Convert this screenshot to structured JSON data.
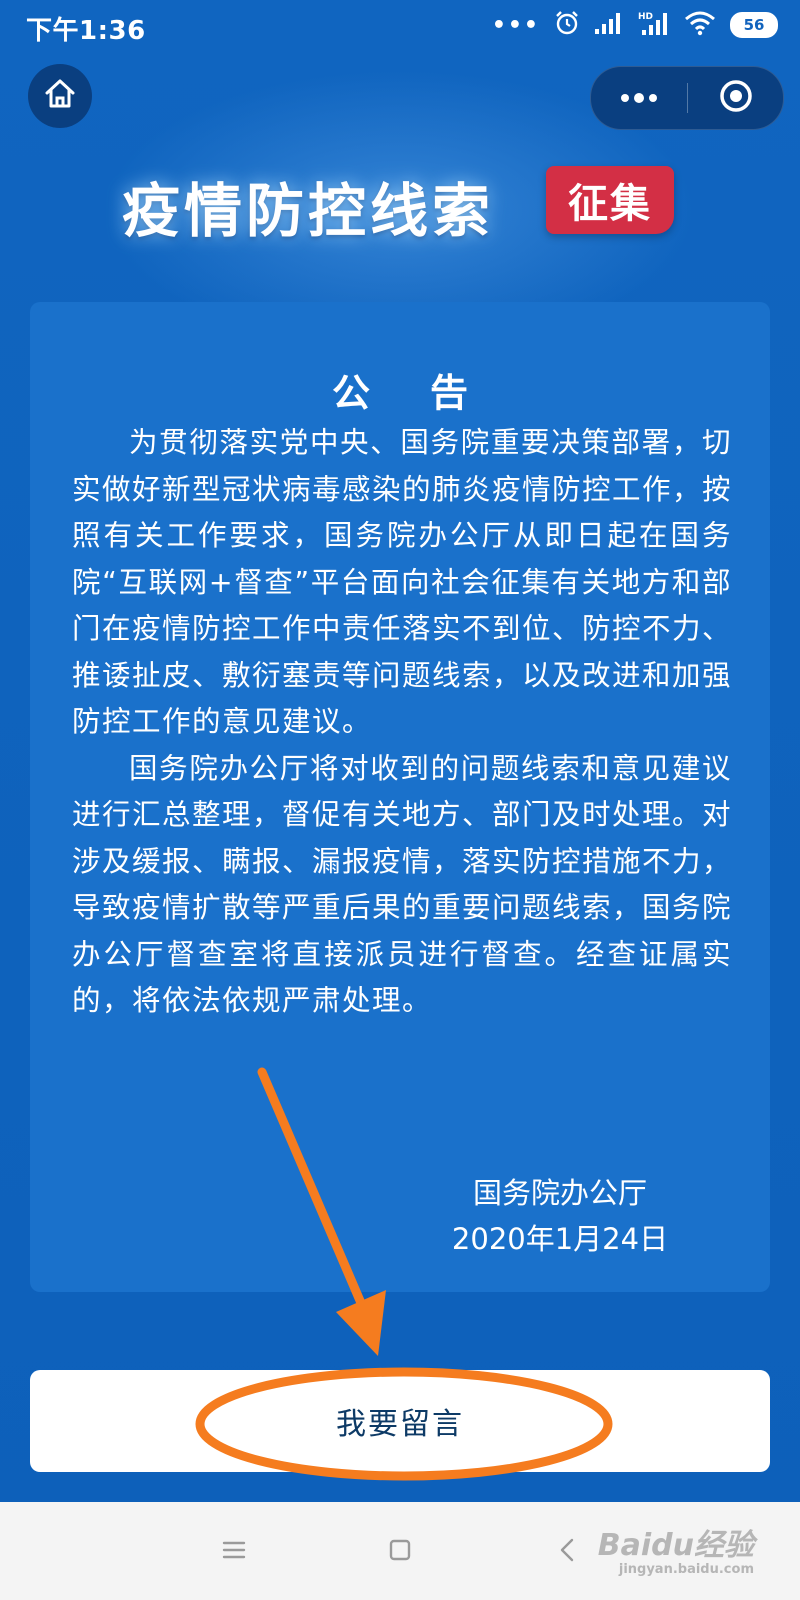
{
  "status_bar": {
    "time": "下午1:36",
    "dots": "•••",
    "battery": "56",
    "icons": [
      "alarm-icon",
      "signal-icon",
      "hd-signal-icon",
      "wifi-icon",
      "battery-icon"
    ]
  },
  "nav": {
    "icons": [
      "home-icon",
      "more-dots-icon",
      "target-icon"
    ]
  },
  "banner": {
    "title": "疫情防控线索",
    "badge": "征集"
  },
  "notice": {
    "heading": "公告",
    "paragraphs": [
      "为贯彻落实党中央、国务院重要决策部署，切实做好新型冠状病毒感染的肺炎疫情防控工作，按照有关工作要求，国务院办公厅从即日起在国务院“互联网+督查”平台面向社会征集有关地方和部门在疫情防控工作中责任落实不到位、防控不力、推诿扯皮、敷衍塞责等问题线索，以及改进和加强防控工作的意见建议。",
      "国务院办公厅将对收到的问题线索和意见建议进行汇总整理，督促有关地方、部门及时处理。对涉及缓报、瞒报、漏报疫情，落实防控措施不力，导致疫情扩散等严重后果的重要问题线索，国务院办公厅督查室将直接派员进行督查。经查证属实的，将依法依规严肃处理。"
    ],
    "signature": "国务院办公厅",
    "date": "2020年1月24日"
  },
  "action": {
    "button_label": "我要留言"
  },
  "bottom_nav": {
    "icons": [
      "menu-icon",
      "home-square-icon",
      "back-icon"
    ]
  },
  "watermark": {
    "main": "Baidu经验",
    "sub": "jingyan.baidu.com"
  },
  "colors": {
    "background": "#1065c0",
    "card": "#1a71cb",
    "badge": "#d32f45",
    "annotation": "#f57c1f",
    "button_text": "#0d3a66"
  }
}
